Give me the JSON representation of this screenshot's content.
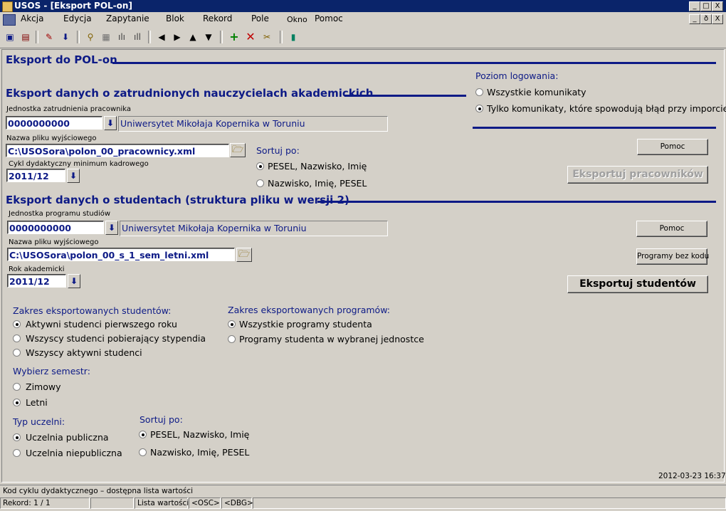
{
  "window": {
    "title": "USOS - [Eksport POL-on]",
    "controls": [
      "_",
      "□",
      "X"
    ],
    "mdi_controls": [
      "_",
      "ð",
      "X"
    ]
  },
  "menu": [
    "Akcja",
    "Edycja",
    "Zapytanie",
    "Blok",
    "Rekord",
    "Pole",
    "Okno",
    "Pomoc"
  ],
  "form": {
    "title": "Eksport do POL-on",
    "logging": {
      "label": "Poziom logowania:",
      "options": [
        "Wszystkie komunikaty",
        "Tylko komunikaty, które spowodują błąd przy imporcie"
      ],
      "selected": 1
    },
    "staff": {
      "title": "Eksport danych o zatrudnionych nauczycielach akademickich",
      "unit_label": "Jednostka zatrudnienia pracownika",
      "unit_code": "0000000000",
      "unit_name": "Uniwersytet Mikołaja Kopernika w Toruniu",
      "file_label": "Nazwa pliku wyjściowego",
      "file_value": "C:\\USOSora\\polon_00_pracownicy.xml",
      "cycle_label": "Cykl dydaktyczny minimum kadrowego",
      "cycle_value": "2011/12",
      "sort_label": "Sortuj po:",
      "sort_options": [
        "PESEL, Nazwisko, Imię",
        "Nazwisko, Imię, PESEL"
      ],
      "sort_selected": 0,
      "help_button": "Pomoc",
      "export_button": "Eksportuj pracowników"
    },
    "students": {
      "title": "Eksport danych o studentach  (struktura pliku w wersji 2)",
      "unit_label": "Jednostka programu studiów",
      "unit_code": "0000000000",
      "unit_name": "Uniwersytet Mikołaja Kopernika w Toruniu",
      "file_label": "Nazwa pliku wyjściowego",
      "file_value": "C:\\USOSora\\polon_00_s_1_sem_letni.xml",
      "year_label": "Rok akademicki",
      "year_value": "2011/12",
      "help_button": "Pomoc",
      "no_code_button": "Programy bez kodu",
      "export_button": "Eksportuj studentów",
      "scope_label": "Zakres eksportowanych studentów:",
      "scope_options": [
        "Aktywni studenci pierwszego roku",
        "Wszyscy studenci pobierający stypendia",
        "Wszyscy aktywni studenci"
      ],
      "scope_selected": 0,
      "programs_label": "Zakres eksportowanych programów:",
      "programs_options": [
        "Wszystkie programy studenta",
        "Programy studenta w wybranej jednostce"
      ],
      "programs_selected": 0,
      "semester_label": "Wybierz semestr:",
      "semester_options": [
        "Zimowy",
        "Letni"
      ],
      "semester_selected": 1,
      "uni_type_label": "Typ uczelni:",
      "uni_type_options": [
        "Uczelnia publiczna",
        "Uczelnia niepubliczna"
      ],
      "uni_type_selected": 0,
      "sort_label": "Sortuj po:",
      "sort_options": [
        "PESEL, Nazwisko, Imię",
        "Nazwisko, Imię, PESEL"
      ],
      "sort_selected": 0
    },
    "timestamp": "2012-03-23 16:37"
  },
  "status": {
    "hint": "Kod cyklu dydaktycznego – dostępna lista wartości",
    "record": "Rekord: 1 / 1",
    "lov": "Lista wartości",
    "osc": "<OSC>",
    "dbg": "<DBG>"
  },
  "colors": {
    "accent": "#0d1a86",
    "titlebar": "#0a246a",
    "background": "#d4d0c8"
  }
}
